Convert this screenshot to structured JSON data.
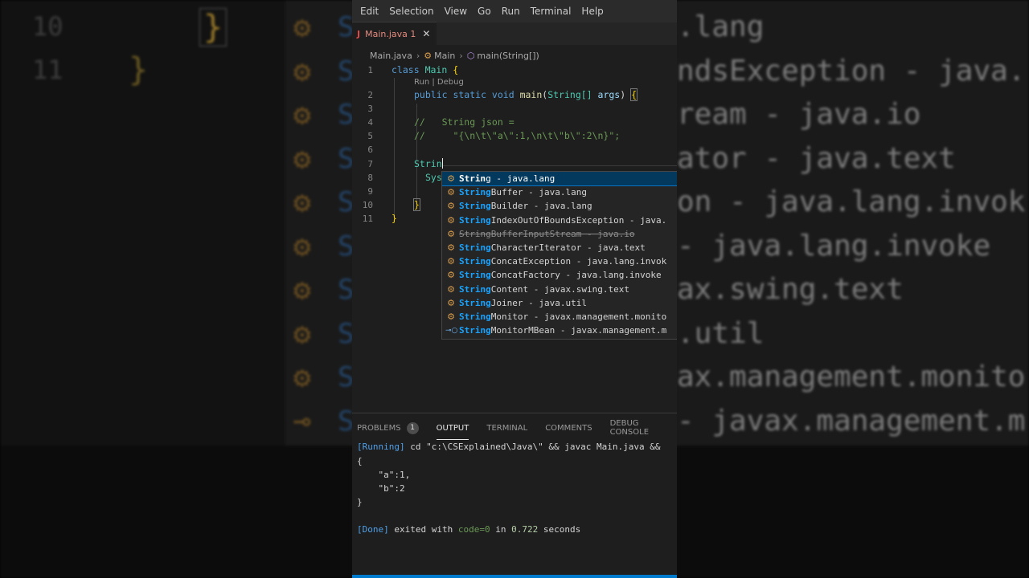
{
  "menu": [
    "Edit",
    "Selection",
    "View",
    "Go",
    "Run",
    "Terminal",
    "Help"
  ],
  "tab": {
    "icon": "J",
    "label": "Main.java 1",
    "close": "✕"
  },
  "breadcrumb": {
    "file": "Main.java",
    "cls": "Main",
    "method": "main(String[])"
  },
  "editor": {
    "line_numbers": [
      "1",
      "2",
      "3",
      "4",
      "5",
      "6",
      "7",
      "8",
      "9",
      "10",
      "11"
    ],
    "codelens": "Run | Debug",
    "line1": {
      "kw": "class",
      "name": "Main",
      "brace": "{"
    },
    "line2": {
      "mods": "public static void",
      "fn": "main",
      "open": "(",
      "type": "String[]",
      "param": "args",
      "close": ")",
      "brace": "{"
    },
    "line4": "//   String json =",
    "line5": "//     \"{\\n\\t\\\"a\\\":1,\\n\\t\\\"b\\\":2\\n}\";",
    "line7": "Strin",
    "line8": "Sys",
    "line10": "}",
    "line11": "}"
  },
  "suggestions": [
    {
      "match": "Strin",
      "rest": "g - java.lang",
      "icon": "class",
      "selected": true
    },
    {
      "match": "String",
      "rest": "Buffer - java.lang",
      "icon": "class"
    },
    {
      "match": "String",
      "rest": "Builder - java.lang",
      "icon": "class"
    },
    {
      "match": "String",
      "rest": "IndexOutOfBoundsException - java.",
      "icon": "class"
    },
    {
      "match": "String",
      "rest": "BufferInputStream - java.io",
      "icon": "class",
      "deprecated": true
    },
    {
      "match": "String",
      "rest": "CharacterIterator - java.text",
      "icon": "class"
    },
    {
      "match": "String",
      "rest": "ConcatException - java.lang.invok",
      "icon": "class"
    },
    {
      "match": "String",
      "rest": "ConcatFactory - java.lang.invoke",
      "icon": "class"
    },
    {
      "match": "String",
      "rest": "Content - javax.swing.text",
      "icon": "class"
    },
    {
      "match": "String",
      "rest": "Joiner - java.util",
      "icon": "class"
    },
    {
      "match": "String",
      "rest": "Monitor - javax.management.monito",
      "icon": "class"
    },
    {
      "match": "String",
      "rest": "MonitorMBean - javax.management.m",
      "icon": "interface"
    }
  ],
  "panel": {
    "tabs": [
      "PROBLEMS",
      "OUTPUT",
      "TERMINAL",
      "COMMENTS",
      "DEBUG CONSOLE"
    ],
    "problems_count": "1",
    "active_tab": "OUTPUT",
    "output": {
      "running_tag": "[Running]",
      "running_cmd": " cd \"c:\\CSExplained\\Java\\\" && javac Main.java &&",
      "json_lines": [
        "{",
        "    \"a\":1,",
        "    \"b\":2",
        "}"
      ],
      "done_tag": "[Done]",
      "done_pre": " exited with ",
      "done_code": "code=0",
      "done_in": " in ",
      "done_time": "0.722",
      "done_unit": " seconds"
    }
  },
  "background": {
    "line_numbers": [
      "10",
      "11"
    ],
    "braces": [
      "}",
      "}"
    ],
    "letter": "S",
    "lines": [
      ".lang",
      "ndsException - java.",
      "ream - java.io",
      "ator - java.text",
      "on - java.lang.invok",
      " - java.lang.invoke",
      "ax.swing.text",
      ".util",
      "ax.management.monito",
      "- javax.management.m"
    ]
  },
  "colors": {
    "accent": "#007acc",
    "selection": "#04395e",
    "match": "#18a3ff",
    "class_icon": "#d69b4a"
  }
}
